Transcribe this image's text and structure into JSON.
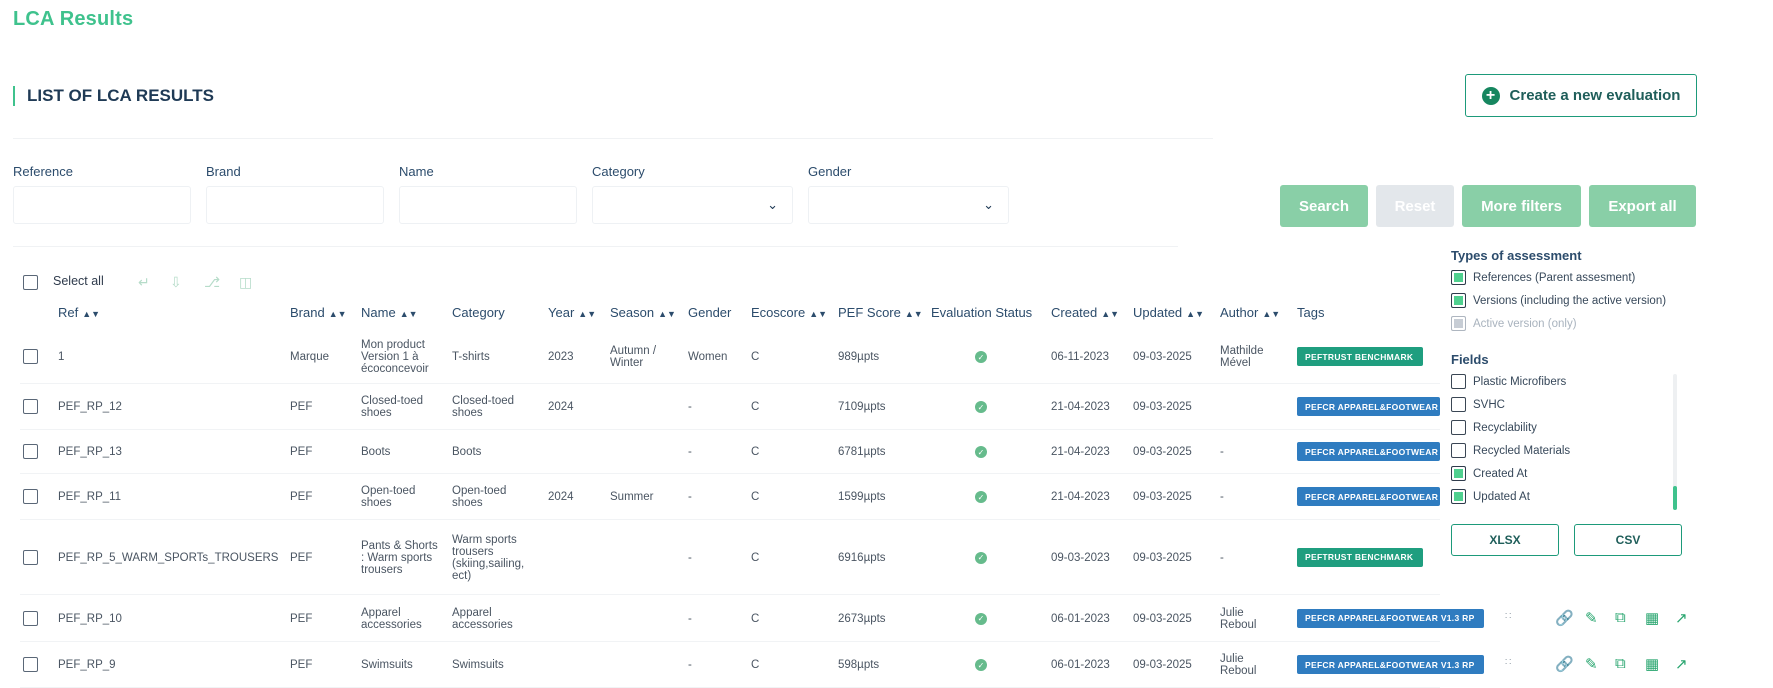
{
  "app": {
    "title": "LCA Results"
  },
  "section": {
    "title": "LIST OF LCA RESULTS"
  },
  "create_button": {
    "label": "Create a new evaluation"
  },
  "filters": {
    "reference": {
      "label": "Reference",
      "value": ""
    },
    "brand": {
      "label": "Brand",
      "value": ""
    },
    "name": {
      "label": "Name",
      "value": ""
    },
    "category": {
      "label": "Category",
      "value": ""
    },
    "gender": {
      "label": "Gender",
      "value": ""
    }
  },
  "actions": {
    "search": "Search",
    "reset": "Reset",
    "more_filters": "More filters",
    "export_all": "Export all"
  },
  "colors": {
    "accent": "#3fc28d",
    "button_active": "#89cfa7",
    "button_disabled": "#e3e7eb",
    "tag_green": "#1f9e7f",
    "tag_blue": "#2f7cc0"
  },
  "table": {
    "select_all": "Select all",
    "toolbar_icons": [
      "unlink-icon",
      "download-icon",
      "branch-icon",
      "trash-icon"
    ],
    "headers": {
      "ref": "Ref",
      "brand": "Brand",
      "name": "Name",
      "category": "Category",
      "year": "Year",
      "season": "Season",
      "gender": "Gender",
      "ecoscore": "Ecoscore",
      "pef": "PEF Score",
      "status": "Evaluation Status",
      "created": "Created",
      "updated": "Updated",
      "author": "Author",
      "tags": "Tags"
    },
    "rows": [
      {
        "ref": "1",
        "brand": "Marque",
        "name": "Mon product Version 1 à écoconcevoir",
        "category": "T-shirts",
        "year": "2023",
        "season": "Autumn / Winter",
        "gender": "Women",
        "ecoscore": "C",
        "pef": "989µpts",
        "created": "06-11-2023",
        "updated": "09-03-2025",
        "author": "Mathilde Mével",
        "tag": "PEFTRUST BENCHMARK",
        "tag_color": "green"
      },
      {
        "ref": "PEF_RP_12",
        "brand": "PEF",
        "name": "Closed-toed shoes",
        "category": "Closed-toed shoes",
        "year": "2024",
        "season": "",
        "gender": "-",
        "ecoscore": "C",
        "pef": "7109µpts",
        "created": "21-04-2023",
        "updated": "09-03-2025",
        "author": "",
        "tag": "PEFCR APPAREL&FOOTWEAR",
        "tag_color": "blue"
      },
      {
        "ref": "PEF_RP_13",
        "brand": "PEF",
        "name": "Boots",
        "category": "Boots",
        "year": "",
        "season": "",
        "gender": "-",
        "ecoscore": "C",
        "pef": "6781µpts",
        "created": "21-04-2023",
        "updated": "09-03-2025",
        "author": "-",
        "tag": "PEFCR APPAREL&FOOTWEAR",
        "tag_color": "blue"
      },
      {
        "ref": "PEF_RP_11",
        "brand": "PEF",
        "name": "Open-toed shoes",
        "category": "Open-toed shoes",
        "year": "2024",
        "season": "Summer",
        "gender": "-",
        "ecoscore": "C",
        "pef": "1599µpts",
        "created": "21-04-2023",
        "updated": "09-03-2025",
        "author": "-",
        "tag": "PEFCR APPAREL&FOOTWEAR",
        "tag_color": "blue"
      },
      {
        "ref": "PEF_RP_5_WARM_SPORTs_TROUSERS",
        "brand": "PEF",
        "name": "Pants & Shorts : Warm sports trousers",
        "category": "Warm sports trousers (skiing,sailing, ect)",
        "year": "",
        "season": "",
        "gender": "-",
        "ecoscore": "C",
        "pef": "6916µpts",
        "created": "09-03-2023",
        "updated": "09-03-2025",
        "author": "-",
        "tag": "PEFTRUST BENCHMARK",
        "tag_color": "green"
      },
      {
        "ref": "PEF_RP_10",
        "brand": "PEF",
        "name": "Apparel accessories",
        "category": "Apparel accessories",
        "year": "",
        "season": "",
        "gender": "-",
        "ecoscore": "C",
        "pef": "2673µpts",
        "created": "06-01-2023",
        "updated": "09-03-2025",
        "author": "Julie Reboul",
        "tag": "PEFCR APPAREL&FOOTWEAR V1.3 RP",
        "tag_color": "blue"
      },
      {
        "ref": "PEF_RP_9",
        "brand": "PEF",
        "name": "Swimsuits",
        "category": "Swimsuits",
        "year": "",
        "season": "",
        "gender": "-",
        "ecoscore": "C",
        "pef": "598µpts",
        "created": "06-01-2023",
        "updated": "09-03-2025",
        "author": "Julie Reboul",
        "tag": "PEFCR APPAREL&FOOTWEAR V1.3 RP",
        "tag_color": "blue"
      }
    ]
  },
  "export_panel": {
    "types_title": "Types of assessment",
    "types": [
      {
        "label": "References (Parent assesment)",
        "checked": true
      },
      {
        "label": "Versions (including the active version)",
        "checked": true
      },
      {
        "label": "Active version (only)",
        "checked": false,
        "disabled": true
      }
    ],
    "fields_title": "Fields",
    "fields": [
      {
        "label": "Plastic Microfibers",
        "checked": false
      },
      {
        "label": "SVHC",
        "checked": false
      },
      {
        "label": "Recyclability",
        "checked": false
      },
      {
        "label": "Recycled Materials",
        "checked": false
      },
      {
        "label": "Created At",
        "checked": true
      },
      {
        "label": "Updated At",
        "checked": true
      }
    ],
    "xlsx": "XLSX",
    "csv": "CSV"
  }
}
